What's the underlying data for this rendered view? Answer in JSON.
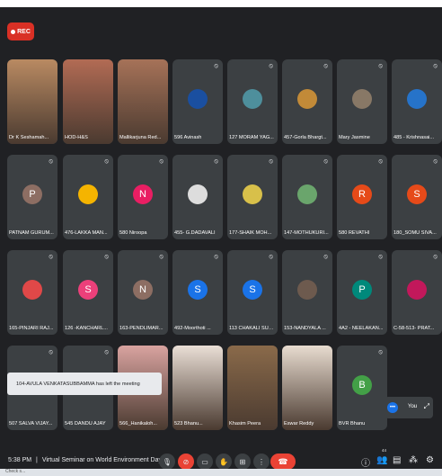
{
  "recording": {
    "label": "REC"
  },
  "colors": {
    "meet_bg": "#202124",
    "tile_bg": "#3c4043",
    "end_call": "#ea4335"
  },
  "tiles": [
    {
      "name": "Dr K Seshamah...",
      "kind": "video",
      "color": "#b98a62"
    },
    {
      "name": "HOD-H&S",
      "kind": "video",
      "color": "#b26b54"
    },
    {
      "name": "Mallikarjuna Red...",
      "kind": "video",
      "color": "#a67258"
    },
    {
      "name": "596 Avinash",
      "kind": "photo",
      "color": "#1a4fa0"
    },
    {
      "name": "127 MORAM YAG...",
      "kind": "photo",
      "color": "#4e8f9c"
    },
    {
      "name": "457-Gorla Bhargt...",
      "kind": "photo",
      "color": "#c28a38"
    },
    {
      "name": "Mary Jasmine",
      "kind": "photo",
      "color": "#887866"
    },
    {
      "name": "485 - Krishnasai...",
      "kind": "photo",
      "color": "#2673c9"
    },
    {
      "name": "PATNAM GURUM...",
      "kind": "letter",
      "letter": "P",
      "color": "#8d6e63"
    },
    {
      "name": "476-LAKKA MAN...",
      "kind": "photo",
      "color": "#f5b400"
    },
    {
      "name": "580 Niroopa",
      "kind": "letter",
      "letter": "N",
      "color": "#e91e63"
    },
    {
      "name": "455- G.DADAVALI",
      "kind": "photo",
      "color": "#dddddd"
    },
    {
      "name": "177-SHAIK MOH...",
      "kind": "photo",
      "color": "#d8c04a"
    },
    {
      "name": "147-MOTHUKURI...",
      "kind": "photo",
      "color": "#6aa56c"
    },
    {
      "name": "580 REVATHI",
      "kind": "letter",
      "letter": "R",
      "color": "#e64a19"
    },
    {
      "name": "180_SOMU SIVA...",
      "kind": "letter",
      "letter": "S",
      "color": "#e64a19"
    },
    {
      "name": "165-PINJARI RAJ...",
      "kind": "photo",
      "color": "#e04848"
    },
    {
      "name": "126 -KANCHARL...",
      "kind": "letter",
      "letter": "S",
      "color": "#ec407a"
    },
    {
      "name": "163-PENDLIMAR...",
      "kind": "letter",
      "letter": "N",
      "color": "#8d6e63"
    },
    {
      "name": "492-Moorthoti ...",
      "kind": "letter",
      "letter": "S",
      "color": "#1a73e8"
    },
    {
      "name": "113 CHAKALI SUB...",
      "kind": "letter",
      "letter": "S",
      "color": "#1a73e8"
    },
    {
      "name": "153-NANDYALA ...",
      "kind": "photo",
      "color": "#6d5a4e"
    },
    {
      "name": "4A2 - NEELAKAN...",
      "kind": "letter",
      "letter": "P",
      "color": "#00897b"
    },
    {
      "name": "C-58-513- PRAT...",
      "kind": "photo",
      "color": "#c2185b"
    },
    {
      "name": "507 SALVA VIJAY...",
      "kind": "hidden",
      "color": "#3c4043"
    },
    {
      "name": "545 DANDU AJAY",
      "kind": "hidden",
      "color": "#3c4043"
    },
    {
      "name": "566_Hanikaloh...",
      "kind": "video",
      "color": "#d9a3a0"
    },
    {
      "name": "523 Bhanu...",
      "kind": "video",
      "color": "#eadfd6"
    },
    {
      "name": "Khasim Peera",
      "kind": "video",
      "color": "#8a6a4a"
    },
    {
      "name": "Eswar Reddy",
      "kind": "video",
      "color": "#e8dcd0"
    },
    {
      "name": "BVR Bhanu",
      "kind": "letter",
      "letter": "B",
      "color": "#43a047"
    },
    {
      "name": "",
      "kind": "self",
      "color": "#3c4043"
    }
  ],
  "notification": {
    "text": "104-AVULA VENKATASUBBAMMA has left the meeting"
  },
  "self_view": {
    "you_label": "You",
    "more_icon": "more-dots-icon"
  },
  "controls": {
    "time": "5:38 PM",
    "separator": "|",
    "meeting_title": "Virtual Seminar on World Environment Day",
    "icons": [
      "mic-icon",
      "camera-off-icon",
      "captions-icon",
      "raise-hand-icon",
      "present-icon",
      "more-icon",
      "end-call-icon"
    ],
    "right_icons": [
      "info-icon",
      "people-icon",
      "chat-icon",
      "activities-icon",
      "host-controls-icon"
    ],
    "people_count": "44"
  },
  "taskbar": {
    "text": "Check s..."
  }
}
